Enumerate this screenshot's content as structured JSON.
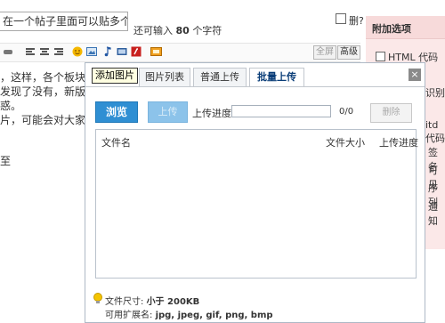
{
  "editor": {
    "title_value": "在一个帖子里面可以贴多个图",
    "char_hint_prefix": "还可输入",
    "char_hint_count": "80",
    "char_hint_suffix": "个字符",
    "delete_label": "删?",
    "toolbar": {
      "fullscreen_label": "全屏",
      "advanced_label": "高级",
      "tooltip": "添加图片"
    },
    "body_lines": [
      "，这样，各个板块都",
      "发现了没有，新版社区",
      "惑。",
      "片，可能会对大家有所",
      "至"
    ]
  },
  "right_panel": {
    "title": "附加选项",
    "option_label": "HTML 代码",
    "fragments": [
      "识别",
      "itd代码",
      "签名",
      "可见",
      "序列",
      "通知"
    ]
  },
  "dialog": {
    "tabs": [
      "图片列表",
      "普通上传",
      "批量上传"
    ],
    "active_tab": "批量上传",
    "close_label": "×",
    "browse_label": "浏览",
    "upload_label": "上传",
    "progress_label": "上传进度",
    "progress_count": "0/0",
    "progress_value": 0,
    "delete_label": "删除",
    "table_headers": {
      "name": "文件名",
      "size": "文件大小",
      "progress": "上传进度"
    },
    "info": {
      "size_prefix": "文件尺寸:",
      "size_value": "小于 200KB",
      "ext_prefix": "可用扩展名:",
      "ext_value": "jpg, jpeg, gif, png, bmp"
    }
  }
}
